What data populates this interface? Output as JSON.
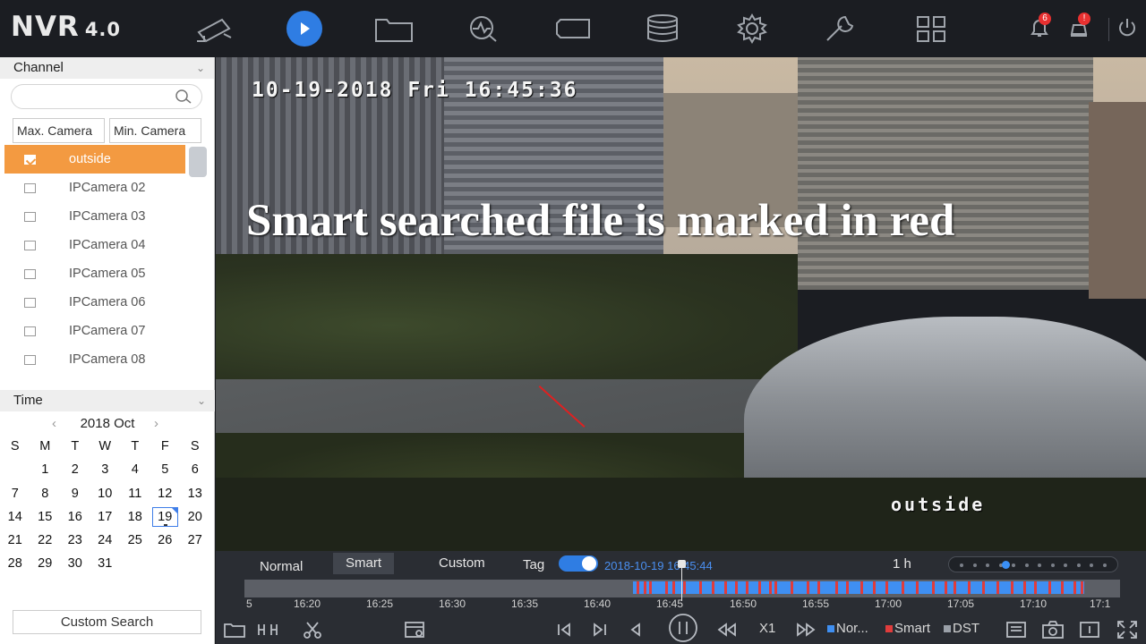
{
  "app": {
    "logo_main": "NVR",
    "logo_version": "4.0"
  },
  "topnav": [
    {
      "icon": "camera-icon"
    },
    {
      "icon": "playback-icon"
    },
    {
      "icon": "folder-icon"
    },
    {
      "icon": "search-analytics-icon"
    },
    {
      "icon": "tag-icon"
    },
    {
      "icon": "storage-icon"
    },
    {
      "icon": "gear-icon"
    },
    {
      "icon": "wrench-icon"
    },
    {
      "icon": "grid-icon"
    }
  ],
  "alerts": {
    "bell_count": "6",
    "alarm_count": "!"
  },
  "sidebar": {
    "channel_title": "Channel",
    "search_placeholder": "",
    "max_camera": "Max. Camera",
    "min_camera": "Min. Camera",
    "cameras": [
      {
        "label": "outside",
        "checked": true
      },
      {
        "label": "IPCamera 02",
        "checked": false
      },
      {
        "label": "IPCamera 03",
        "checked": false
      },
      {
        "label": "IPCamera 04",
        "checked": false
      },
      {
        "label": "IPCamera 05",
        "checked": false
      },
      {
        "label": "IPCamera 06",
        "checked": false
      },
      {
        "label": "IPCamera 07",
        "checked": false
      },
      {
        "label": "IPCamera 08",
        "checked": false
      }
    ],
    "time_title": "Time",
    "calendar": {
      "month_label": "2018 Oct",
      "weekdays": [
        "S",
        "M",
        "T",
        "W",
        "T",
        "F",
        "S"
      ],
      "days": [
        "",
        "1",
        "2",
        "3",
        "4",
        "5",
        "6",
        "7",
        "8",
        "9",
        "10",
        "11",
        "12",
        "13",
        "14",
        "15",
        "16",
        "17",
        "18",
        "19",
        "20",
        "21",
        "22",
        "23",
        "24",
        "25",
        "26",
        "27",
        "28",
        "29",
        "30",
        "31"
      ],
      "selected_day": "19"
    },
    "custom_search": "Custom Search"
  },
  "video": {
    "osd_time": "10-19-2018 Fri 16:45:36",
    "note": "Smart searched file is marked in red",
    "camera_name": "outside"
  },
  "playback": {
    "tabs": [
      "Normal",
      "Smart",
      "Custom"
    ],
    "selected_tab": "Smart",
    "tag_label": "Tag",
    "tag_enabled": true,
    "timestamp": "2018-10-19 16:45:44",
    "span": "1 h",
    "timeline_ticks": [
      "5",
      "16:20",
      "16:25",
      "16:30",
      "16:35",
      "16:40",
      "16:45",
      "16:50",
      "16:55",
      "17:00",
      "17:05",
      "17:10",
      "17:1"
    ],
    "colors": {
      "normal": "#3f8ff2",
      "smart": "#e03c3c",
      "dst": "#9aa0a8"
    },
    "speed": "X1",
    "legend": {
      "normal": "Nor...",
      "smart": "Smart",
      "dst": "DST"
    }
  }
}
